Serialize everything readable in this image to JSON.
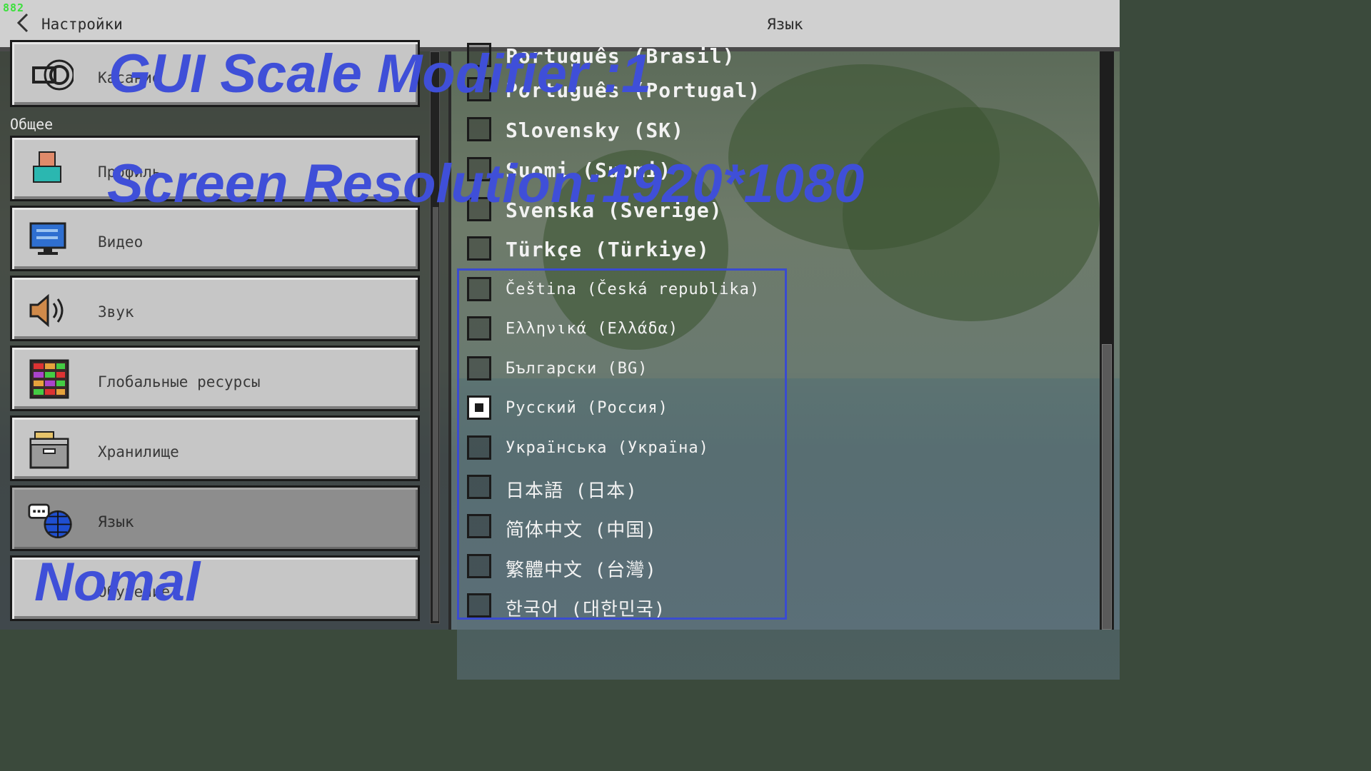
{
  "hud": {
    "fps": "882"
  },
  "topbar": {
    "back_title": "Настройки",
    "page_title": "Язык"
  },
  "sidebar": {
    "section_header": "Общее",
    "items": [
      {
        "label": "Касание",
        "icon": "touch-hand-icon",
        "active": false
      },
      {
        "label": "Профиль",
        "icon": "profile-icon",
        "active": false
      },
      {
        "label": "Видео",
        "icon": "monitor-icon",
        "active": false
      },
      {
        "label": "Звук",
        "icon": "speaker-icon",
        "active": false
      },
      {
        "label": "Глобальные ресурсы",
        "icon": "resource-pack-icon",
        "active": false
      },
      {
        "label": "Хранилище",
        "icon": "storage-box-icon",
        "active": false
      },
      {
        "label": "Язык",
        "icon": "language-globe-icon",
        "active": true
      },
      {
        "label": "Обучение",
        "icon": "tutorial-icon",
        "active": false
      }
    ]
  },
  "languages": [
    {
      "label": "Português (Brasil)",
      "checked": false
    },
    {
      "label": "Português (Portugal)",
      "checked": false
    },
    {
      "label": "Slovensky (SK)",
      "checked": false
    },
    {
      "label": "Suomi (Suomi)",
      "checked": false
    },
    {
      "label": "Svenska (Sverige)",
      "checked": false
    },
    {
      "label": "Türkçe (Türkiye)",
      "checked": false
    },
    {
      "label": "Čeština (Česká republika)",
      "checked": false
    },
    {
      "label": "Ελληνικά (Ελλάδα)",
      "checked": false
    },
    {
      "label": "Български (BG)",
      "checked": false
    },
    {
      "label": "Русский (Россия)",
      "checked": true
    },
    {
      "label": "Українська (Україна)",
      "checked": false
    },
    {
      "label": "日本語 (日本)",
      "checked": false
    },
    {
      "label": "简体中文 (中国)",
      "checked": false
    },
    {
      "label": "繁體中文 (台灣)",
      "checked": false
    },
    {
      "label": "한국어 (대한민국)",
      "checked": false
    }
  ],
  "overlay": {
    "scale_text": "GUI Scale Modifier :1",
    "resolution_text": "Screen Resolution:1920*1080",
    "mode_text": "Nomal"
  },
  "colors": {
    "overlay": "#3f4fd8",
    "highlight_box": "#3a4bd0",
    "fps": "#3ce03c"
  }
}
